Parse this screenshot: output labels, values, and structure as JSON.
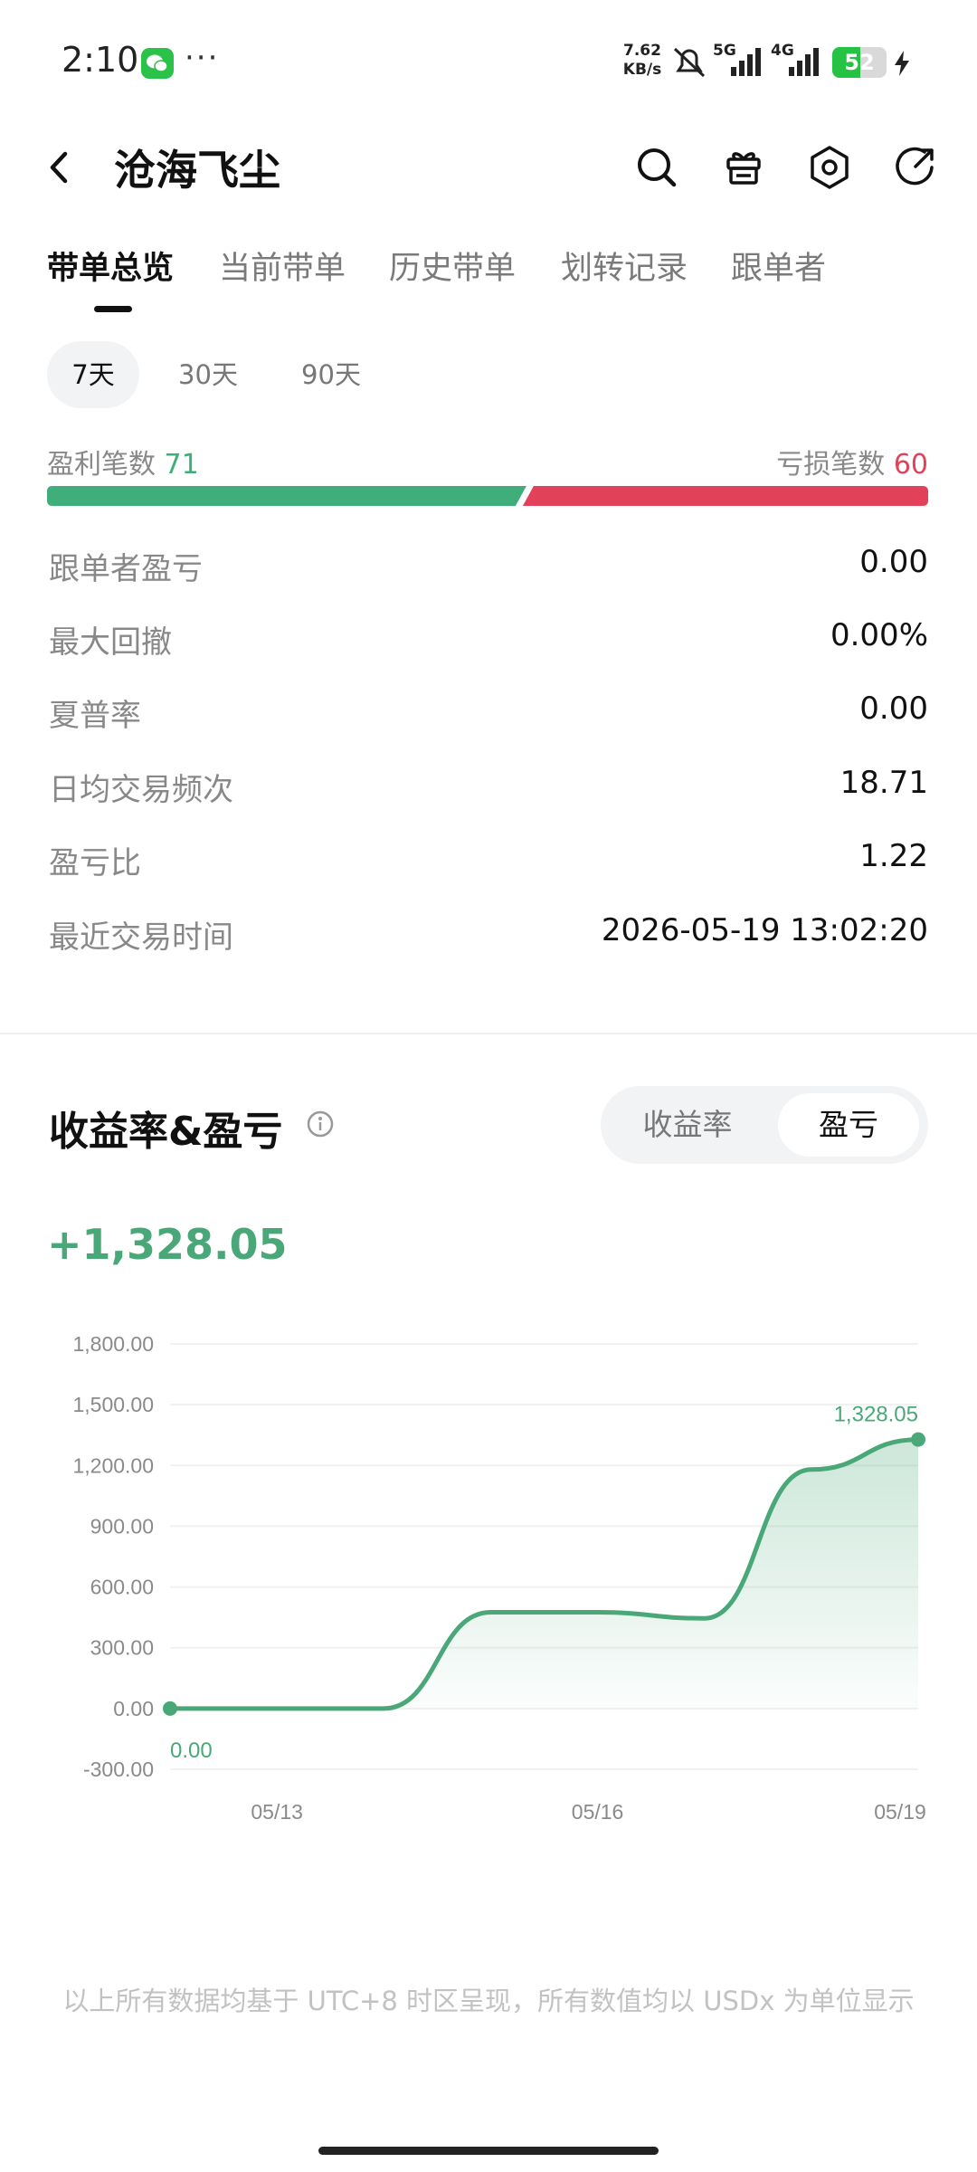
{
  "status_bar": {
    "time": "2:10",
    "more": "···",
    "speed_value": "7.62",
    "speed_unit": "KB/s",
    "net_5g": "5G",
    "net_4g": "4G",
    "battery": "52",
    "battery_level": 0.52
  },
  "header": {
    "title": "沧海飞尘",
    "icons": [
      "back-icon",
      "search-icon",
      "gift-icon",
      "settings-icon",
      "share-icon"
    ]
  },
  "tabs": [
    {
      "label": "带单总览",
      "active": true
    },
    {
      "label": "当前带单",
      "active": false
    },
    {
      "label": "历史带单",
      "active": false
    },
    {
      "label": "划转记录",
      "active": false
    },
    {
      "label": "跟单者",
      "active": false
    }
  ],
  "periods": [
    {
      "label": "7天",
      "active": true
    },
    {
      "label": "30天",
      "active": false
    },
    {
      "label": "90天",
      "active": false
    }
  ],
  "win_loss": {
    "win_label": "盈利笔数",
    "win_count": "71",
    "loss_label": "亏损笔数",
    "loss_count": "60",
    "win_ratio": 0.542
  },
  "stats": [
    {
      "label": "跟单者盈亏",
      "value": "0.00"
    },
    {
      "label": "最大回撤",
      "value": "0.00%"
    },
    {
      "label": "夏普率",
      "value": "0.00"
    },
    {
      "label": "日均交易频次",
      "value": "18.71"
    },
    {
      "label": "盈亏比",
      "value": "1.22"
    },
    {
      "label": "最近交易时间",
      "value": "2026-05-19 13:02:20"
    }
  ],
  "section": {
    "title": "收益率&盈亏",
    "toggle": [
      {
        "label": "收益率",
        "active": false
      },
      {
        "label": "盈亏",
        "active": true
      }
    ],
    "total": "+1,328.05"
  },
  "colors": {
    "profit": "#3fae7a",
    "loss": "#e1425a",
    "line": "#4aa878"
  },
  "chart_data": {
    "type": "area",
    "x": [
      "05/12",
      "05/13",
      "05/14",
      "05/15",
      "05/16",
      "05/17",
      "05/18",
      "05/19"
    ],
    "y": [
      0,
      0,
      0,
      475,
      475,
      445,
      1180,
      1328.05
    ],
    "x_tick_labels": [
      "05/13",
      "05/16",
      "05/19"
    ],
    "y_tick_labels": [
      "1,800.00",
      "1,500.00",
      "1,200.00",
      "900.00",
      "600.00",
      "300.00",
      "0.00",
      "-300.00"
    ],
    "ylim": [
      -300,
      1800
    ],
    "start_label": "0.00",
    "end_label": "1,328.05",
    "grid": true
  },
  "footer": {
    "note": "以上所有数据均基于 UTC+8 时区呈现，所有数值均以 USDx 为单位显示"
  }
}
